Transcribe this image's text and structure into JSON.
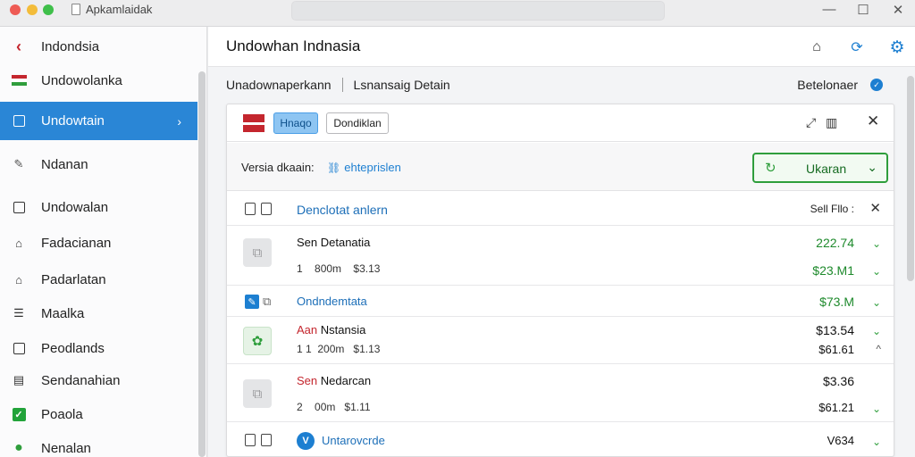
{
  "window": {
    "title": "Apkamlaidak"
  },
  "sidebar": {
    "items": [
      {
        "label": "Indondsia"
      },
      {
        "label": "Undowolanka"
      },
      {
        "label": "Undowtain",
        "active": true
      },
      {
        "label": "Ndanan"
      },
      {
        "label": "Undowalan"
      },
      {
        "label": "Fadacianan"
      },
      {
        "label": "Padarlatan"
      },
      {
        "label": "Maalka"
      },
      {
        "label": "Peodlands"
      },
      {
        "label": "Sendanahian"
      },
      {
        "label": "Poaola"
      },
      {
        "label": "Nenalan"
      }
    ]
  },
  "header": {
    "title": "Undowhan Indnasia"
  },
  "breadcrumb": {
    "first": "Unadownaperkann",
    "second": "Lsnansaig Detain",
    "right": "Betelonaer"
  },
  "toolbar": {
    "primary_label": "Hnaqo",
    "secondary_label": "Dondiklan"
  },
  "filter": {
    "label": "Versia dkaain:",
    "link": "ehteprislen",
    "select_value": "Ukaran"
  },
  "list": {
    "header": {
      "title": "Denclotat anlern",
      "right": "Sell Fllo :"
    },
    "rows": [
      {
        "name": "Sen Detanatia",
        "meta_a": "1",
        "meta_b": "800m",
        "meta_c": "$3.13",
        "value_1": "222.74",
        "value_2": "$23.M1"
      },
      {
        "name": "Ondndemtata",
        "value_1": "$73.M"
      },
      {
        "name_accent": "Aan",
        "name": "Nstansia",
        "meta_a": "1 1",
        "meta_b": "200m",
        "meta_c": "$1.13",
        "value_1": "$13.54",
        "value_2": "$61.61"
      },
      {
        "name_accent": "Sen",
        "name": "Nedarcan",
        "meta_a": "2",
        "meta_b": "00m",
        "meta_c": "$1.11",
        "value_1": "$3.36",
        "value_2": "$61.21"
      },
      {
        "name": "Untarovcrde",
        "value_1": "V634"
      }
    ]
  },
  "colors": {
    "accent_blue": "#2a86d6",
    "green": "#2f9e3c",
    "red": "#c4262e"
  }
}
